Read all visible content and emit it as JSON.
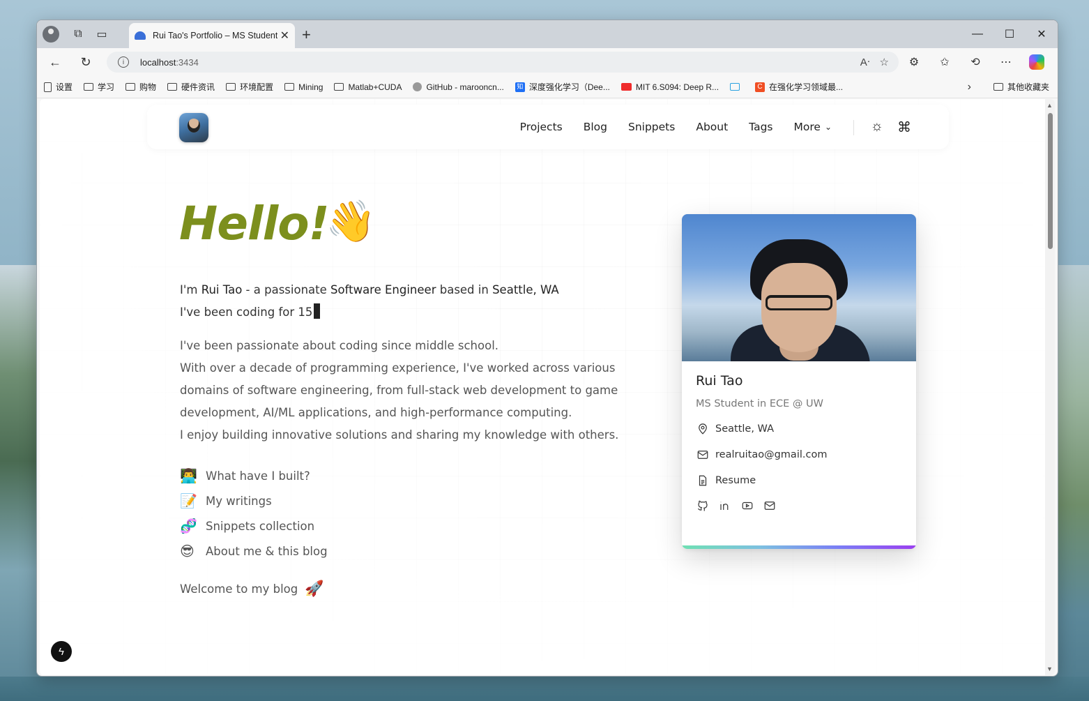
{
  "browser": {
    "tab_title": "Rui Tao's Portfolio – MS Student i",
    "url_host": "localhost",
    "url_port": ":3434",
    "bookmarks": [
      {
        "icon": "file-icon",
        "label": "设置"
      },
      {
        "icon": "folder-icon",
        "label": "学习"
      },
      {
        "icon": "folder-icon",
        "label": "购物"
      },
      {
        "icon": "folder-icon",
        "label": "硬件资讯"
      },
      {
        "icon": "folder-icon",
        "label": "环境配置"
      },
      {
        "icon": "folder-icon",
        "label": "Mining"
      },
      {
        "icon": "folder-icon",
        "label": "Matlab+CUDA"
      },
      {
        "icon": "github-icon",
        "label": "GitHub - marooncn..."
      },
      {
        "icon": "zhihu-icon",
        "label": "深度强化学习（Dee..."
      },
      {
        "icon": "youtube-icon",
        "label": "MIT 6.S094: Deep R..."
      },
      {
        "icon": "bilibili-icon",
        "label": ""
      },
      {
        "icon": "csdn-icon",
        "label": "在强化学习领域最..."
      }
    ],
    "other_bookmarks": "其他收藏夹"
  },
  "site": {
    "nav": [
      "Projects",
      "Blog",
      "Snippets",
      "About",
      "Tags",
      "More"
    ],
    "hero": {
      "greeting": "Hello!",
      "wave_emoji": "👋",
      "line1_prefix": "I'm ",
      "line1_name": "Rui Tao",
      "line1_mid": " - a passionate ",
      "line1_role": "Software Engineer",
      "line1_mid2": " based in ",
      "line1_location": "Seattle, WA",
      "line2": "I've been coding for 15"
    },
    "bio": [
      "I've been passionate about coding since middle school.",
      "With over a decade of programming experience, I've worked across various domains of software engineering, from full-stack web development to game development, AI/ML applications, and high-performance computing.",
      "I enjoy building innovative solutions and sharing my knowledge with others."
    ],
    "links": [
      {
        "emoji": "👨‍💻",
        "label": "What have I built?"
      },
      {
        "emoji": "📝",
        "label": "My writings"
      },
      {
        "emoji": "🧬",
        "label": "Snippets collection"
      },
      {
        "emoji": "😎",
        "label": "About me & this blog"
      }
    ],
    "welcome": "Welcome to my blog",
    "welcome_emoji": "🚀",
    "card": {
      "name": "Rui Tao",
      "role": "MS Student in ECE @ UW",
      "location": "Seattle, WA",
      "email": "realruitao@gmail.com",
      "resume": "Resume",
      "socials": [
        "github-icon",
        "linkedin-icon",
        "youtube-icon",
        "mail-icon"
      ]
    }
  }
}
